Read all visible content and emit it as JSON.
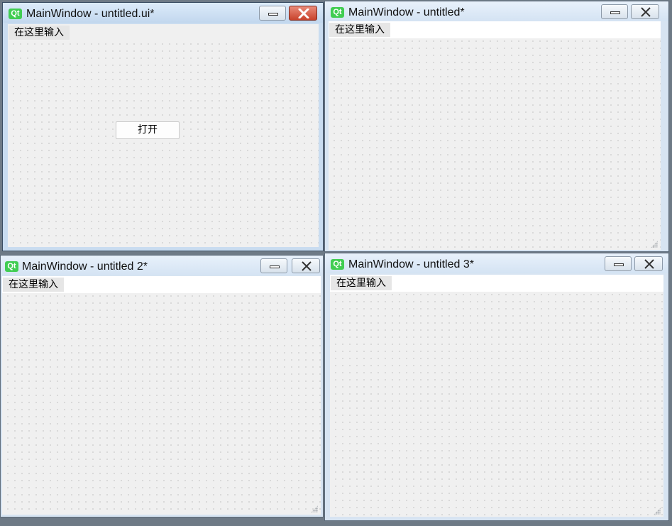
{
  "windows": [
    {
      "title": "MainWindow - untitled.ui*",
      "icon_label": "Qt",
      "menu_placeholder": "在这里输入",
      "button_label": "打开",
      "active": true
    },
    {
      "title": "MainWindow - untitled*",
      "icon_label": "Qt",
      "menu_placeholder": "在这里输入"
    },
    {
      "title": "MainWindow - untitled 2*",
      "icon_label": "Qt",
      "menu_placeholder": "在这里输入"
    },
    {
      "title": "MainWindow - untitled 3*",
      "icon_label": "Qt",
      "menu_placeholder": "在这里输入"
    }
  ],
  "colors": {
    "qt_icon": "#41cd52",
    "close_active": "#c8422c",
    "canvas": "#f0f0f0"
  },
  "icons": [
    "qt-logo-icon",
    "minimize-icon",
    "close-icon",
    "resize-grip-icon"
  ]
}
